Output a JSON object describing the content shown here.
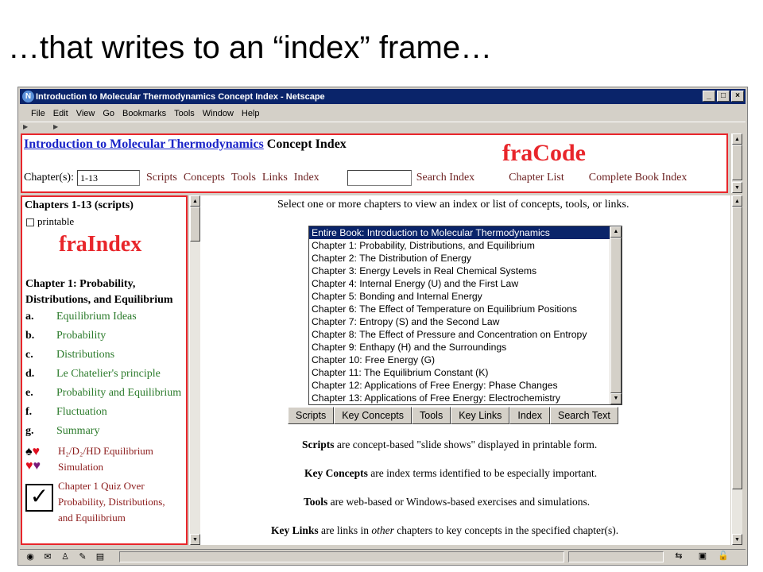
{
  "slide": {
    "title": "…that writes to an “index” frame…"
  },
  "window": {
    "title": "Introduction to Molecular Thermodynamics Concept Index - Netscape",
    "app_icon": "N",
    "min_glyph": "_",
    "max_glyph": "□",
    "close_glyph": "×",
    "menu": [
      "File",
      "Edit",
      "View",
      "Go",
      "Bookmarks",
      "Tools",
      "Window",
      "Help"
    ]
  },
  "code_frame": {
    "book_link": "Introduction to Molecular Thermodynamics",
    "title_suffix": "Concept Index",
    "frame_label": "fraCode",
    "chapters_label": "Chapter(s):",
    "chapters_value": "1-13",
    "links": [
      "Scripts",
      "Concepts",
      "Tools",
      "Links",
      "Index"
    ],
    "search_value": "",
    "search_button": "Search Index",
    "chapter_list": "Chapter List",
    "complete_index": "Complete Book Index"
  },
  "index_frame": {
    "heading": "Chapters 1-13 (scripts)",
    "printable_label": "printable",
    "frame_label": "fraIndex",
    "chapter_title": "Chapter 1: Probability, Distributions, and Equilibrium",
    "items": [
      {
        "letter": "a.",
        "text": "Equilibrium Ideas"
      },
      {
        "letter": "b.",
        "text": "Probability"
      },
      {
        "letter": "c.",
        "text": "Distributions"
      },
      {
        "letter": "d.",
        "text": "Le Chatelier's principle"
      },
      {
        "letter": "e.",
        "text": "Probability and Equilibrium"
      },
      {
        "letter": "f.",
        "text": "Fluctuation"
      },
      {
        "letter": "g.",
        "text": "Summary"
      }
    ],
    "simulation_line1": "H₂/D₂/HD Equilibrium",
    "simulation_line2": "Simulation",
    "quiz_line1": "Chapter 1 Quiz Over",
    "quiz_line2": "Probability, Distributions,",
    "quiz_line3": "and Equilibrium",
    "check_glyph": "✓"
  },
  "main_frame": {
    "instruction": "Select one or more chapters to view an index or list of concepts, tools, or links.",
    "chapter_options": [
      "Entire Book: Introduction to Molecular Thermodynamics",
      "Chapter 1: Probability, Distributions, and Equilibrium",
      "Chapter 2: The Distribution of Energy",
      "Chapter 3: Energy Levels in Real Chemical Systems",
      "Chapter 4: Internal Energy (U) and the First Law",
      "Chapter 5: Bonding and Internal Energy",
      "Chapter 6: The Effect of Temperature on Equilibrium Positions",
      "Chapter 7: Entropy (S) and the Second Law",
      "Chapter 8: The Effect of Pressure and Concentration on Entropy",
      "Chapter 9: Enthapy (H) and the Surroundings",
      "Chapter 10: Free Energy (G)",
      "Chapter 11: The Equilibrium Constant (K)",
      "Chapter 12: Applications of Free Energy: Phase Changes",
      "Chapter 13: Applications of Free Energy: Electrochemistry"
    ],
    "buttons": [
      "Scripts",
      "Key Concepts",
      "Tools",
      "Key Links",
      "Index",
      "Search Text"
    ],
    "desc_scripts_term": "Scripts",
    "desc_scripts_text": " are concept-based \"slide shows\" displayed in printable form.",
    "desc_concepts_term": "Key Concepts",
    "desc_concepts_text": " are index terms identified to be especially important.",
    "desc_tools_term": "Tools",
    "desc_tools_text": " are web-based or Windows-based exercises and simulations.",
    "desc_links_term": "Key Links",
    "desc_links_pre": " are links in ",
    "desc_links_em": "other",
    "desc_links_post": " chapters to key concepts in the specified chapter(s)."
  },
  "colors": {
    "frame_outline": "#e8262b",
    "link_blue": "#1a24c8",
    "item_green": "#2a7a2a",
    "selection": "#0a246a"
  }
}
